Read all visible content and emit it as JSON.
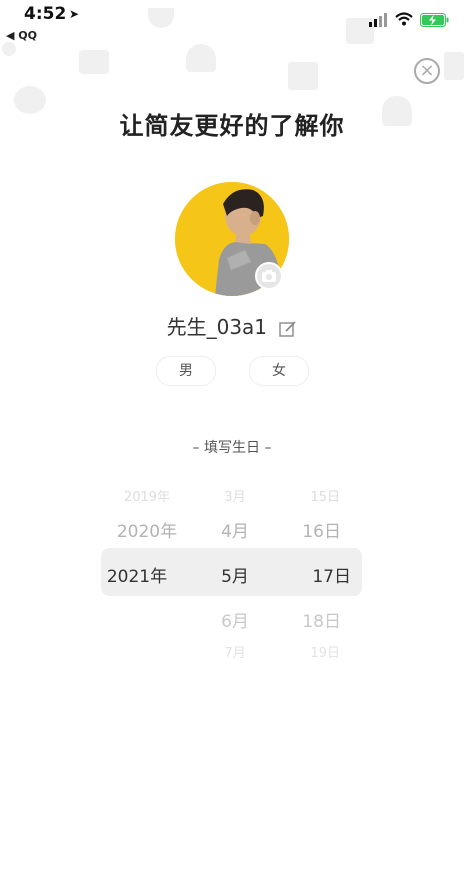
{
  "status_bar": {
    "time": "4:52",
    "location_arrow": "➤",
    "back_label": "◀ QQ",
    "colors": {
      "battery": "#34c759"
    }
  },
  "header": {
    "close_icon": "×",
    "title": "让简友更好的了解你"
  },
  "profile": {
    "nickname": "先生_03a1",
    "avatar_bg": "#f5c518"
  },
  "gender": {
    "male": "男",
    "female": "女"
  },
  "birthday": {
    "label": "– 填写生日 –",
    "years": [
      "2019年",
      "2020年",
      "2021年"
    ],
    "months": [
      "3月",
      "4月",
      "5月",
      "6月",
      "7月"
    ],
    "days": [
      "15日",
      "16日",
      "17日",
      "18日",
      "19日"
    ],
    "selected": {
      "year": "2021年",
      "month": "5月",
      "day": "17日"
    }
  }
}
